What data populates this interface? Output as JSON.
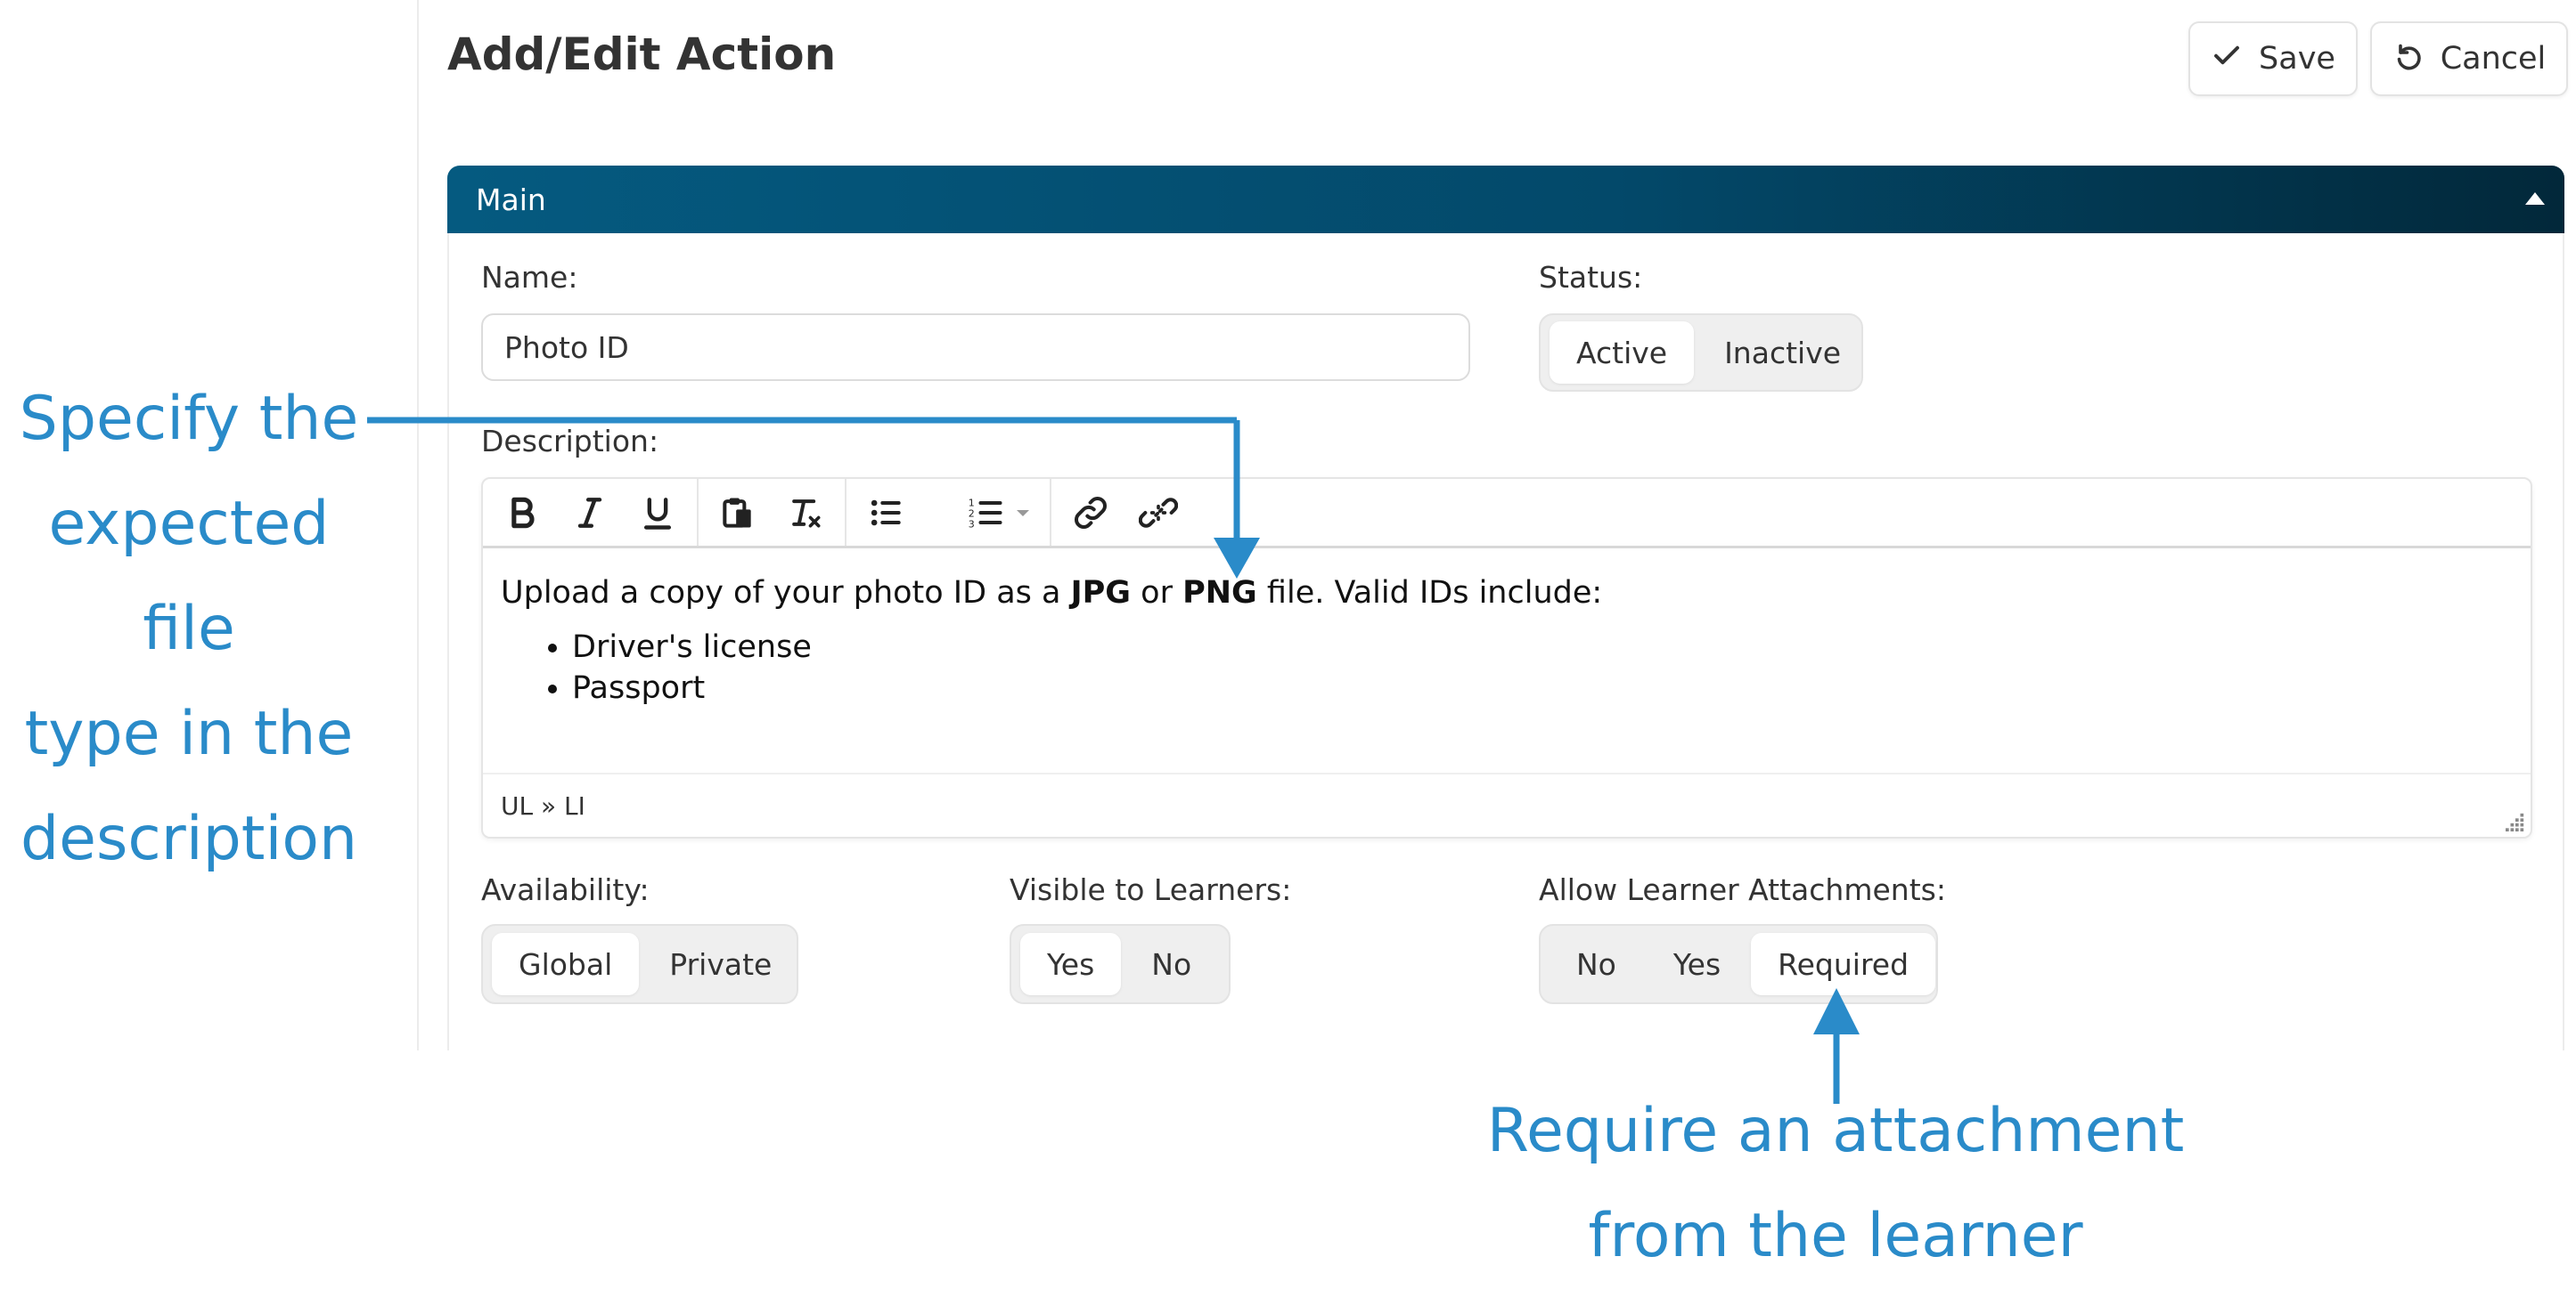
{
  "page": {
    "title": "Add/Edit Action"
  },
  "actions": {
    "save_label": "Save",
    "cancel_label": "Cancel",
    "save_icon": "check-icon",
    "cancel_icon": "undo-icon"
  },
  "section": {
    "title": "Main",
    "toggle_icon": "collapse-triangle-icon"
  },
  "fields": {
    "name": {
      "label": "Name:",
      "value": "Photo ID"
    },
    "status": {
      "label": "Status:",
      "options": [
        "Active",
        "Inactive"
      ],
      "selected": "Active"
    },
    "description": {
      "label": "Description:",
      "toolbar": [
        "bold-icon",
        "italic-icon",
        "underline-icon",
        "paste-icon",
        "clear-format-icon",
        "bullet-list-icon",
        "numbered-list-icon",
        "link-icon",
        "unlink-icon"
      ],
      "content": {
        "intro_prefix": "Upload a copy of your photo ID as a",
        "jpg": "JPG",
        "or": "or",
        "png": "PNG",
        "intro_suffix": "file. Valid IDs include:",
        "items": [
          "Driver's license",
          "Passport"
        ]
      },
      "path": "UL » LI"
    },
    "availability": {
      "label": "Availability:",
      "options": [
        "Global",
        "Private"
      ],
      "selected": "Global"
    },
    "visible_to_learners": {
      "label": "Visible to Learners:",
      "options": [
        "Yes",
        "No"
      ],
      "selected": "Yes"
    },
    "learner_attachments": {
      "label": "Allow Learner Attachments:",
      "options": [
        "No",
        "Yes",
        "Required"
      ],
      "selected": "Required"
    }
  },
  "annotations": {
    "left": [
      "Specify the",
      "expected file",
      "type in the",
      "description"
    ],
    "bottom": [
      "Require an attachment",
      "from the learner"
    ],
    "color": "#2a8bc9"
  },
  "colors": {
    "header_start": "#055a80",
    "header_end": "#02283a",
    "annotation": "#2a8bc9"
  }
}
